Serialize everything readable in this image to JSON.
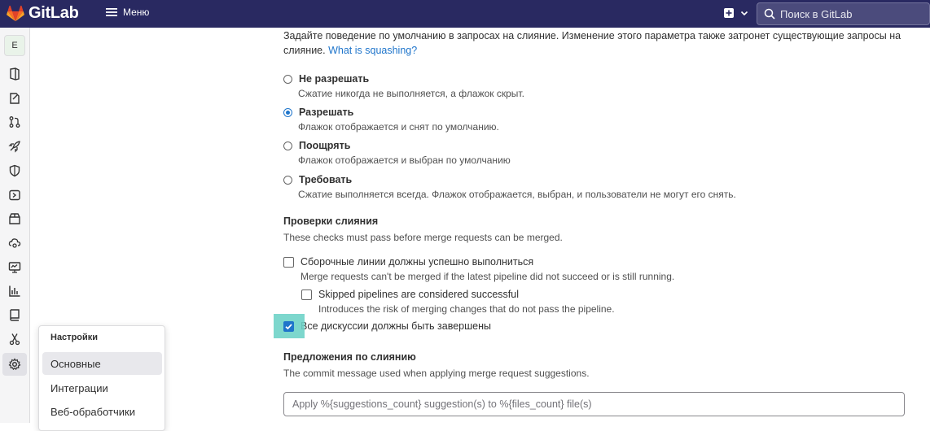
{
  "topbar": {
    "app_name": "GitLab",
    "menu_label": "Меню",
    "search_placeholder": "Поиск в GitLab",
    "bg_color": "#292961"
  },
  "sidebar": {
    "avatar_letter": "E",
    "icons": [
      "project-overview-icon",
      "issues-icon",
      "merge-requests-icon",
      "ci-cd-rocket-icon",
      "security-shield-icon",
      "deployments-icon",
      "packages-icon",
      "infrastructure-icon",
      "monitor-icon",
      "analytics-icon",
      "wiki-icon",
      "snippets-icon",
      "settings-gear-icon"
    ]
  },
  "flyout": {
    "title": "Настройки",
    "items": [
      "Основные",
      "Интеграции",
      "Веб-обработчики"
    ]
  },
  "main": {
    "intro_line1": "Задайте поведение по умолчанию в запросах на слияние. Изменение этого параметра также затронет существующие запросы на",
    "intro_line2_prefix": "слияние.",
    "intro_link": "What is squashing?",
    "squash_options": [
      {
        "label": "Не разрешать",
        "help": "Сжатие никогда не выполняется, а флажок скрыт.",
        "checked": false
      },
      {
        "label": "Разрешать",
        "help": "Флажок отображается и снят по умолчанию.",
        "checked": true
      },
      {
        "label": "Поощрять",
        "help": "Флажок отображается и выбран по умолчанию",
        "checked": false
      },
      {
        "label": "Требовать",
        "help": "Сжатие выполняется всегда. Флажок отображается, выбран, и пользователи не могут его снять.",
        "checked": false
      }
    ],
    "merge_checks": {
      "title": "Проверки слияния",
      "subtitle": "These checks must pass before merge requests can be merged.",
      "pipelines_label": "Сборочные линии должны успешно выполниться",
      "pipelines_help": "Merge requests can't be merged if the latest pipeline did not succeed or is still running.",
      "skipped_label": "Skipped pipelines are considered successful",
      "skipped_help": "Introduces the risk of merging changes that do not pass the pipeline.",
      "discussions_label": "Все дискуссии должны быть завершены"
    },
    "suggestions": {
      "title": "Предложения по слиянию",
      "subtitle": "The commit message used when applying merge request suggestions.",
      "input_placeholder": "Apply %{suggestions_count} suggestion(s) to %{files_count} file(s)"
    }
  }
}
